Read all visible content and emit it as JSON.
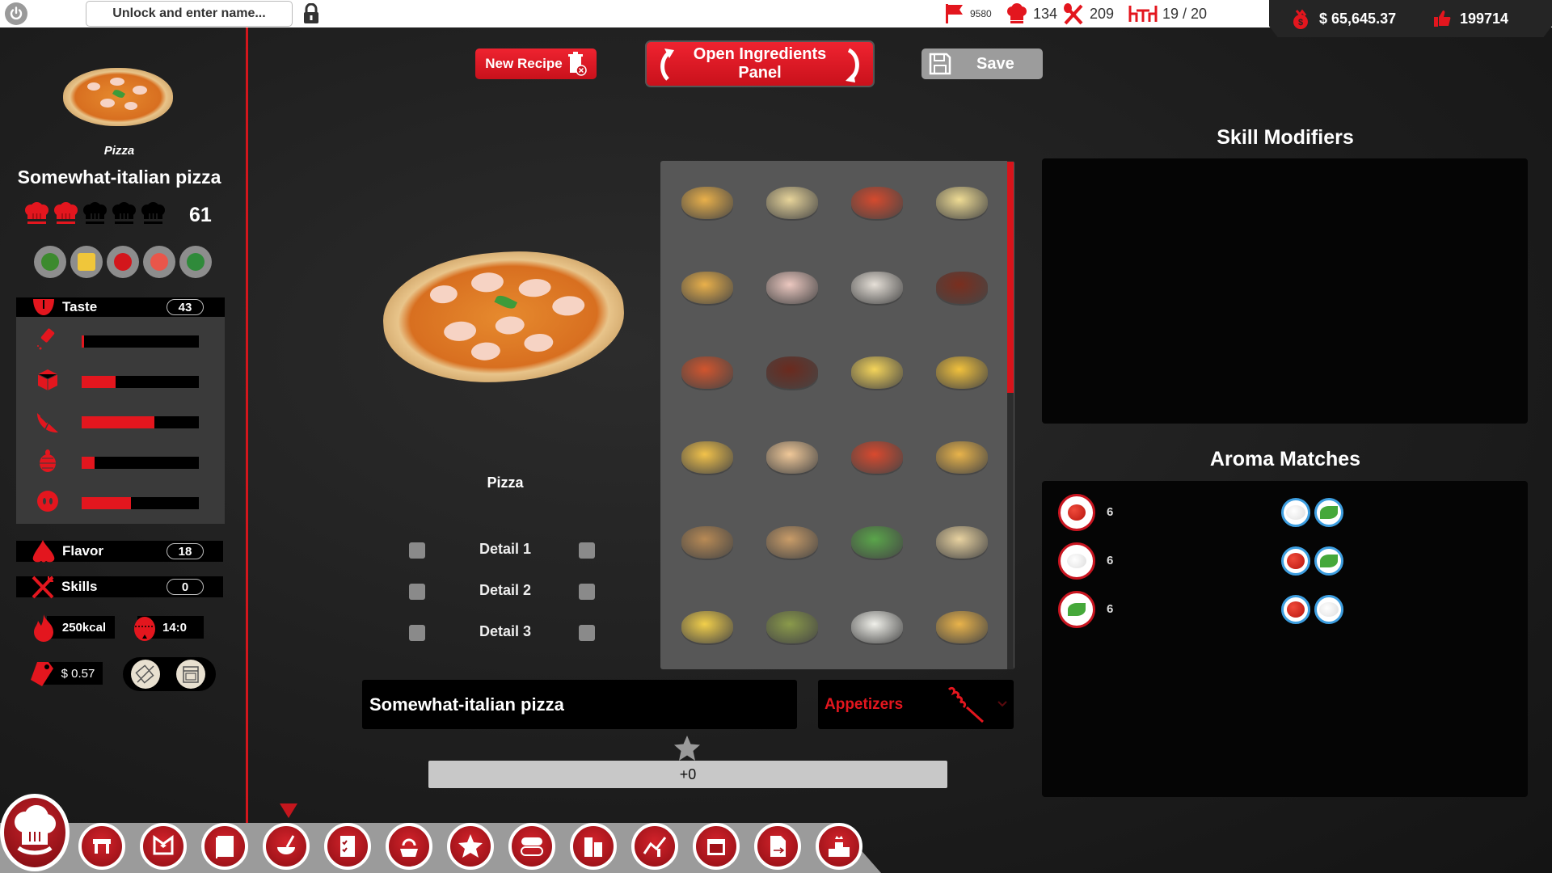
{
  "topbar": {
    "name_placeholder": "Unlock and enter name...",
    "stats": [
      {
        "icon": "flag-icon",
        "value": "9580"
      },
      {
        "icon": "chef-hat-icon",
        "value": "134"
      },
      {
        "icon": "utensils-icon",
        "value": "209"
      },
      {
        "icon": "table-icon",
        "value": "19 / 20"
      }
    ],
    "money": "$ 65,645.37",
    "likes": "199714",
    "accent_color": "#e3161e"
  },
  "sidebar": {
    "category": "Pizza",
    "recipe_name": "Somewhat-italian pizza",
    "rating": {
      "hats_filled": 2,
      "hats_total": 5,
      "score": "61"
    },
    "diet_icons": [
      "vegetable-icon",
      "cheese-icon",
      "spicy-icon",
      "healthy-heart-icon",
      "leafy-greens-icon"
    ],
    "taste": {
      "label": "Taste",
      "value": "43",
      "bars": [
        {
          "icon": "salt-icon",
          "fill": 0.02
        },
        {
          "icon": "sugar-cube-icon",
          "fill": 0.29
        },
        {
          "icon": "citrus-sour-icon",
          "fill": 0.62
        },
        {
          "icon": "bitter-hop-icon",
          "fill": 0.11
        },
        {
          "icon": "umami-icon",
          "fill": 0.42
        }
      ]
    },
    "flavor": {
      "label": "Flavor",
      "value": "18"
    },
    "skills": {
      "label": "Skills",
      "value": "0"
    },
    "calories": "250kcal",
    "cook_time": "14:0",
    "price": "$ 0.57"
  },
  "toolbar": {
    "new_recipe": "New Recipe",
    "open_ingredients": "Open Ingredients Panel",
    "save": "Save"
  },
  "dish": {
    "label": "Pizza",
    "details": [
      "Detail 1",
      "Detail 2",
      "Detail 3"
    ],
    "name_input": "Somewhat-italian pizza",
    "course_select": "Appetizers",
    "star_bonus": "+0"
  },
  "dish_grid": [
    [
      "empanadas",
      "calzone",
      "deep-dish-pizza",
      "ravioli"
    ],
    [
      "empanadas-2",
      "poke-salad",
      "grilled-chicken",
      "steak"
    ],
    [
      "lasagna",
      "chili-bowl",
      "omelette",
      "paella"
    ],
    [
      "spaghetti",
      "cake-slice",
      "pizza-margherita",
      "quiche"
    ],
    [
      "arancini",
      "rice-cake",
      "green-salad",
      "sandwich"
    ],
    [
      "fried-rice",
      "soup-bowl",
      "fish-fillet",
      "taco"
    ]
  ],
  "skill_modifiers": {
    "title": "Skill Modifiers"
  },
  "aroma_matches": {
    "title": "Aroma Matches",
    "rows": [
      {
        "ingredient": "tomato",
        "count": "6",
        "matches": [
          "mozzarella",
          "basil"
        ]
      },
      {
        "ingredient": "mozzarella",
        "count": "6",
        "matches": [
          "tomato",
          "basil"
        ]
      },
      {
        "ingredient": "basil",
        "count": "6",
        "matches": [
          "tomato",
          "mozzarella"
        ]
      }
    ]
  },
  "bottom_nav": [
    "chef-menu",
    "restaurant",
    "staff",
    "menu",
    "recipes",
    "tasks",
    "ingredients-delivery",
    "reviews",
    "settings-toggle",
    "city-buildings",
    "statistics",
    "calendar",
    "contracts",
    "rankings"
  ],
  "bottom_nav_active": "recipes"
}
